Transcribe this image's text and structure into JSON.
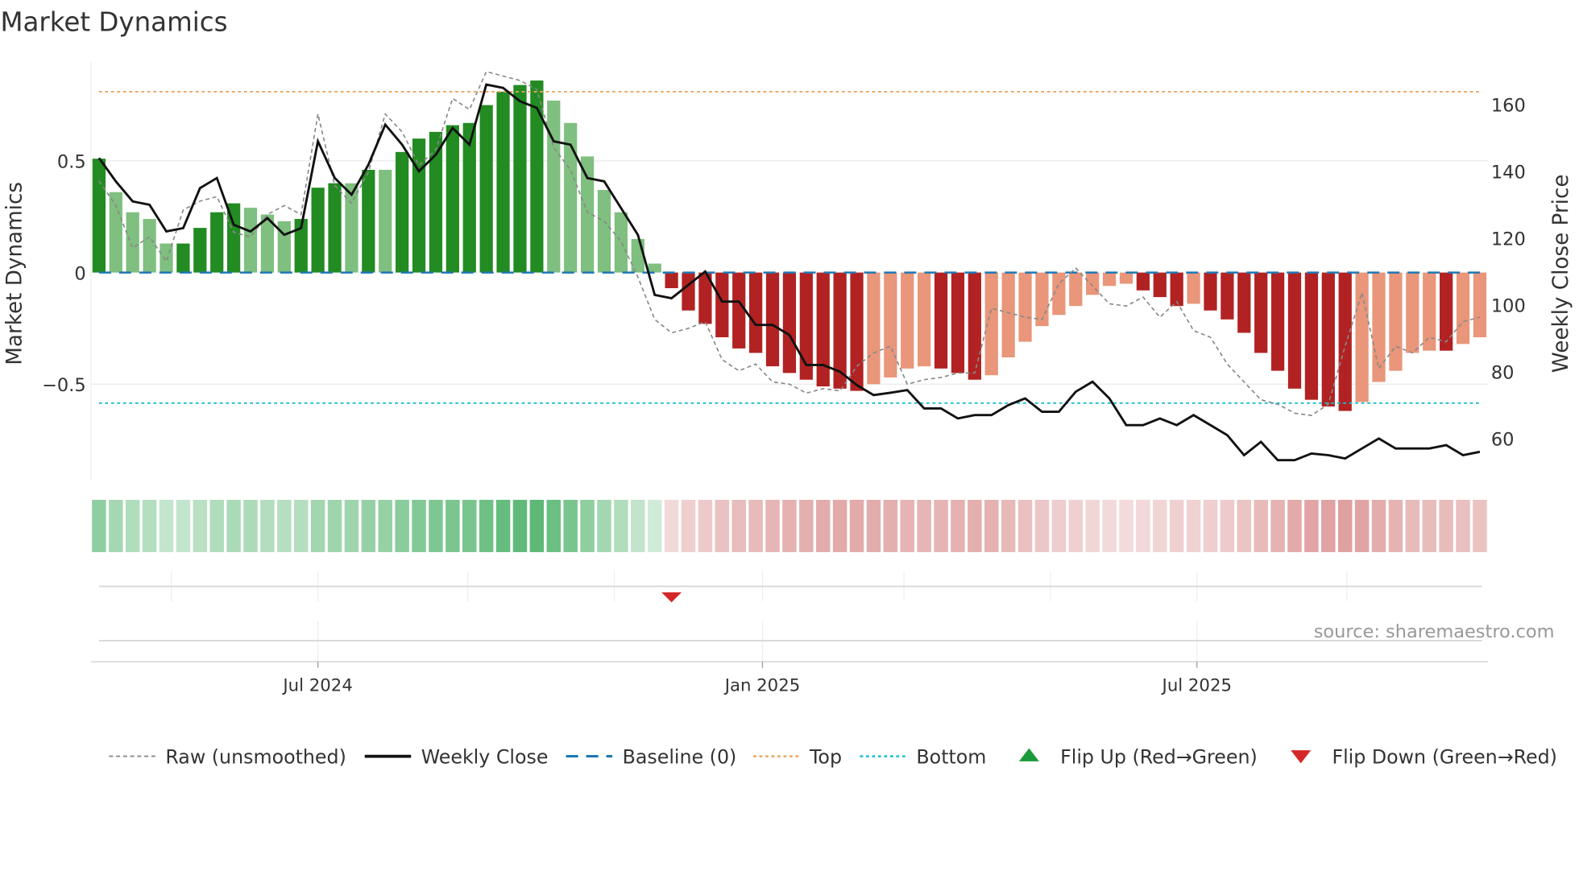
{
  "chart_data": {
    "type": "bar",
    "title": "Market Dynamics",
    "ylabel": "Market Dynamics",
    "y2label": "Weekly Close Price",
    "ylim": [
      -0.94,
      0.94
    ],
    "y2lim": [
      50,
      170
    ],
    "yticks": [
      {
        "v": 0.5,
        "label": "0.5"
      },
      {
        "v": 0,
        "label": "0"
      },
      {
        "v": -0.5,
        "label": "−0.5"
      }
    ],
    "y2ticks": [
      {
        "v": 160,
        "label": "160"
      },
      {
        "v": 140,
        "label": "140"
      },
      {
        "v": 120,
        "label": "120"
      },
      {
        "v": 100,
        "label": "100"
      },
      {
        "v": 80,
        "label": "80"
      },
      {
        "v": 60,
        "label": "60"
      }
    ],
    "xticks": [
      {
        "week": 13,
        "label": "Jul 2024"
      },
      {
        "week": 39.4,
        "label": "Jan 2025"
      },
      {
        "week": 65.2,
        "label": "Jul 2025"
      }
    ],
    "minor_grid_weeks": [
      4.3,
      13,
      21.9,
      30.6,
      39.4,
      47.8,
      56.5,
      65.2,
      74.1
    ],
    "top": 0.81,
    "bottom": -0.585,
    "baseline": 0,
    "dynamics": [
      0.51,
      0.36,
      0.27,
      0.24,
      0.13,
      0.13,
      0.2,
      0.27,
      0.31,
      0.29,
      0.26,
      0.23,
      0.24,
      0.38,
      0.4,
      0.4,
      0.46,
      0.46,
      0.54,
      0.6,
      0.63,
      0.66,
      0.67,
      0.75,
      0.81,
      0.84,
      0.86,
      0.77,
      0.67,
      0.52,
      0.37,
      0.27,
      0.15,
      0.04,
      -0.07,
      -0.17,
      -0.23,
      -0.29,
      -0.34,
      -0.36,
      -0.42,
      -0.45,
      -0.48,
      -0.51,
      -0.52,
      -0.53,
      -0.5,
      -0.47,
      -0.43,
      -0.42,
      -0.43,
      -0.45,
      -0.48,
      -0.46,
      -0.38,
      -0.31,
      -0.24,
      -0.19,
      -0.15,
      -0.1,
      -0.06,
      -0.05,
      -0.08,
      -0.11,
      -0.15,
      -0.14,
      -0.17,
      -0.21,
      -0.27,
      -0.36,
      -0.44,
      -0.52,
      -0.57,
      -0.6,
      -0.62,
      -0.58,
      -0.49,
      -0.44,
      -0.36,
      -0.35,
      -0.35,
      -0.32,
      -0.29
    ],
    "strong": [
      1,
      0,
      0,
      0,
      0,
      1,
      1,
      1,
      1,
      0,
      0,
      0,
      1,
      1,
      1,
      0,
      1,
      0,
      1,
      1,
      1,
      1,
      1,
      1,
      1,
      1,
      1,
      0,
      0,
      0,
      0,
      0,
      0,
      0,
      1,
      1,
      1,
      1,
      1,
      1,
      1,
      1,
      1,
      1,
      1,
      1,
      0,
      0,
      0,
      0,
      1,
      1,
      1,
      0,
      0,
      0,
      0,
      0,
      0,
      0,
      0,
      0,
      1,
      1,
      1,
      0,
      1,
      1,
      1,
      1,
      1,
      1,
      1,
      1,
      1,
      0,
      0,
      0,
      0,
      0,
      1,
      0,
      0
    ],
    "raw": [
      0.41,
      0.3,
      0.11,
      0.16,
      0.05,
      0.28,
      0.32,
      0.34,
      0.18,
      0.16,
      0.26,
      0.3,
      0.26,
      0.71,
      0.39,
      0.31,
      0.45,
      0.71,
      0.63,
      0.48,
      0.55,
      0.78,
      0.73,
      0.9,
      0.88,
      0.86,
      0.82,
      0.56,
      0.46,
      0.27,
      0.23,
      0.14,
      -0.02,
      -0.21,
      -0.27,
      -0.25,
      -0.22,
      -0.39,
      -0.44,
      -0.41,
      -0.49,
      -0.5,
      -0.54,
      -0.52,
      -0.53,
      -0.42,
      -0.36,
      -0.33,
      -0.5,
      -0.48,
      -0.47,
      -0.45,
      -0.45,
      -0.16,
      -0.18,
      -0.2,
      -0.21,
      -0.05,
      0.02,
      -0.06,
      -0.14,
      -0.15,
      -0.11,
      -0.2,
      -0.13,
      -0.26,
      -0.29,
      -0.41,
      -0.49,
      -0.57,
      -0.59,
      -0.63,
      -0.64,
      -0.59,
      -0.33,
      -0.09,
      -0.43,
      -0.33,
      -0.36,
      -0.29,
      -0.31,
      -0.22,
      -0.2
    ],
    "close": [
      144,
      137,
      131,
      130,
      122,
      123,
      135,
      138,
      124,
      122,
      126,
      121,
      123,
      149,
      138,
      133,
      142,
      154,
      148,
      140,
      145,
      153,
      148,
      166,
      165,
      161,
      159,
      149,
      148,
      138,
      137,
      129,
      121,
      103,
      102,
      106,
      110,
      101,
      101,
      94,
      94,
      91,
      82,
      82,
      80,
      76,
      73,
      73.7,
      74.5,
      69,
      69,
      66,
      67,
      67,
      70,
      72,
      68,
      68,
      74,
      77,
      72,
      64,
      64,
      66,
      64,
      67,
      64,
      61,
      55,
      59,
      53.5,
      53.5,
      55.5,
      55,
      54,
      57,
      60,
      57,
      57,
      57,
      58,
      55,
      56
    ],
    "flips": [
      {
        "week": 34,
        "type": "down"
      }
    ],
    "legend": [
      {
        "key": "raw",
        "label": "Raw (unsmoothed)"
      },
      {
        "key": "close",
        "label": "Weekly Close"
      },
      {
        "key": "baseline",
        "label": "Baseline (0)"
      },
      {
        "key": "top",
        "label": "Top"
      },
      {
        "key": "bottom",
        "label": "Bottom"
      },
      {
        "key": "flipup",
        "label": "Flip Up (Red→Green)"
      },
      {
        "key": "flipdown",
        "label": "Flip Down (Green→Red)"
      }
    ],
    "source": "source: sharemaestro.com",
    "colors": {
      "green_strong": "#228b22",
      "green_light": "#7fbf7f",
      "red_strong": "#b22222",
      "red_light": "#e9967a",
      "top": "#e8a560",
      "bottom": "#17becf",
      "baseline": "#1f77b4",
      "close": "#111111",
      "raw": "#888888",
      "flipup": "#1a9a3a",
      "flipdown": "#d62728"
    }
  }
}
